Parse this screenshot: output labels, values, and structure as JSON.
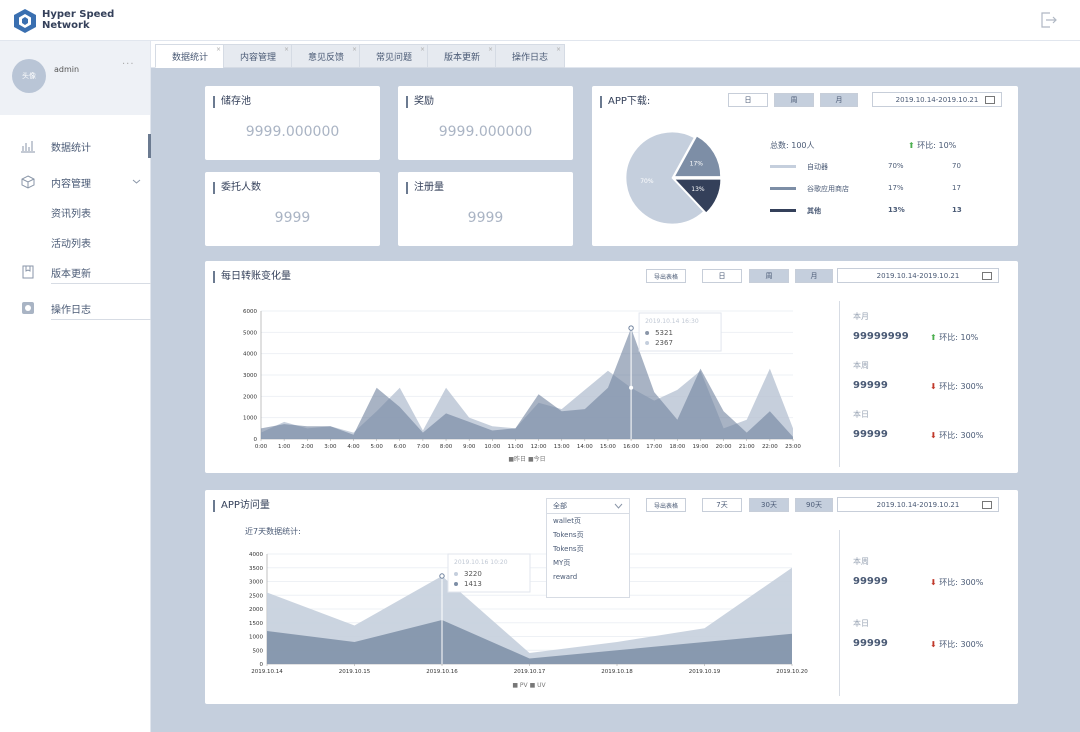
{
  "brand": {
    "line1": "Hyper Speed",
    "line2": "Network"
  },
  "user": {
    "avatar_text": "头像",
    "name": "admin",
    "menu": "···"
  },
  "nav": [
    {
      "label": "数据统计"
    },
    {
      "label": "内容管理"
    },
    {
      "label": "资讯列表"
    },
    {
      "label": "活动列表"
    },
    {
      "label": "版本更新"
    },
    {
      "label": "操作日志"
    }
  ],
  "tabs": [
    {
      "label": "数据统计"
    },
    {
      "label": "内容管理"
    },
    {
      "label": "意见反馈"
    },
    {
      "label": "常见问题"
    },
    {
      "label": "版本更新"
    },
    {
      "label": "操作日志"
    }
  ],
  "cards": {
    "pool": {
      "title": "储存池",
      "value": "9999.000000"
    },
    "reward": {
      "title": "奖励",
      "value": "9999.000000"
    },
    "delegates": {
      "title": "委托人数",
      "value": "9999"
    },
    "registrations": {
      "title": "注册量",
      "value": "9999"
    }
  },
  "app_download": {
    "title": "APP下载:",
    "periods": [
      "日",
      "周",
      "月"
    ],
    "date_range": "2019.10.14-2019.10.21",
    "total": "总数: 100人",
    "change": "环比: 10%",
    "legend": [
      {
        "name": "自动器",
        "pct": "70%",
        "count": "70",
        "color": "#c5cfdd"
      },
      {
        "name": "谷歌应用商店",
        "pct": "17%",
        "count": "17",
        "color": "#7d8ea6"
      },
      {
        "name": "其他",
        "pct": "13%",
        "count": "13",
        "color": "#34405a"
      }
    ],
    "pie_labels": [
      "70%",
      "17%",
      "13%"
    ]
  },
  "transfer": {
    "title": "每日转账变化量",
    "export": "导出表格",
    "periods": [
      "日",
      "周",
      "月"
    ],
    "date_range": "2019.10.14-2019.10.21",
    "tooltip": {
      "time": "2019.10.14 16:30",
      "v1": "5321",
      "v2": "2367"
    },
    "legend": "■昨日 ■今日",
    "stats": [
      {
        "label": "本月",
        "value": "99999999",
        "change": "环比: 10%",
        "dir": "up"
      },
      {
        "label": "本周",
        "value": "99999",
        "change": "环比: 300%",
        "dir": "down"
      },
      {
        "label": "本日",
        "value": "99999",
        "change": "环比: 300%",
        "dir": "down"
      }
    ]
  },
  "visits": {
    "title": "APP访问量",
    "subtitle": "近7天数据统计:",
    "export": "导出表格",
    "periods": [
      "7天",
      "30天",
      "90天"
    ],
    "date_range": "2019.10.14-2019.10.21",
    "dropdown": {
      "selected": "全部",
      "options": [
        "wallet页",
        "Tokens页",
        "Tokens页",
        "MY页",
        "reward"
      ]
    },
    "tooltip": {
      "time": "2019.10.16 10:20",
      "v1": "3220",
      "v2": "1413"
    },
    "legend": "■ PV ■ UV",
    "stats": [
      {
        "label": "本周",
        "value": "99999",
        "change": "环比: 300%",
        "dir": "down"
      },
      {
        "label": "本日",
        "value": "99999",
        "change": "环比: 300%",
        "dir": "down"
      }
    ]
  },
  "chart_data": [
    {
      "type": "pie",
      "categories": [
        "自动器",
        "谷歌应用商店",
        "其他"
      ],
      "values": [
        70,
        17,
        13
      ]
    },
    {
      "type": "area",
      "x": [
        "0:00",
        "1:00",
        "2:00",
        "3:00",
        "4:00",
        "5:00",
        "6:00",
        "7:00",
        "8:00",
        "9:00",
        "10:00",
        "11:00",
        "12:00",
        "13:00",
        "14:00",
        "15:00",
        "16:00",
        "17:00",
        "18:00",
        "19:00",
        "20:00",
        "21:00",
        "22:00",
        "23:00"
      ],
      "series": [
        {
          "name": "昨日",
          "values": [
            300,
            800,
            500,
            600,
            300,
            1300,
            2400,
            400,
            2400,
            1000,
            600,
            500,
            1700,
            1400,
            2300,
            3200,
            2400,
            1800,
            2300,
            3200,
            500,
            900,
            3300,
            500
          ]
        },
        {
          "name": "今日",
          "values": [
            500,
            700,
            600,
            600,
            200,
            2400,
            1500,
            300,
            1200,
            800,
            400,
            500,
            2100,
            1300,
            1400,
            2400,
            5200,
            2200,
            900,
            3300,
            1300,
            300,
            1300,
            100
          ]
        }
      ],
      "yticks": [
        0,
        1000,
        2000,
        3000,
        4000,
        5000,
        6000
      ],
      "ylim": [
        0,
        6000
      ]
    },
    {
      "type": "area",
      "x": [
        "2019.10.14",
        "2019.10.15",
        "2019.10.16",
        "2019.10.17",
        "2019.10.18",
        "2019.10.19",
        "2019.10.20"
      ],
      "series": [
        {
          "name": "PV",
          "values": [
            2600,
            1400,
            3200,
            400,
            800,
            1300,
            3500
          ]
        },
        {
          "name": "UV",
          "values": [
            1200,
            800,
            1600,
            200,
            500,
            800,
            1100
          ]
        }
      ],
      "yticks": [
        0,
        500,
        1000,
        1500,
        2000,
        2500,
        3000,
        3500,
        4000
      ],
      "ylim": [
        0,
        4000
      ]
    }
  ]
}
